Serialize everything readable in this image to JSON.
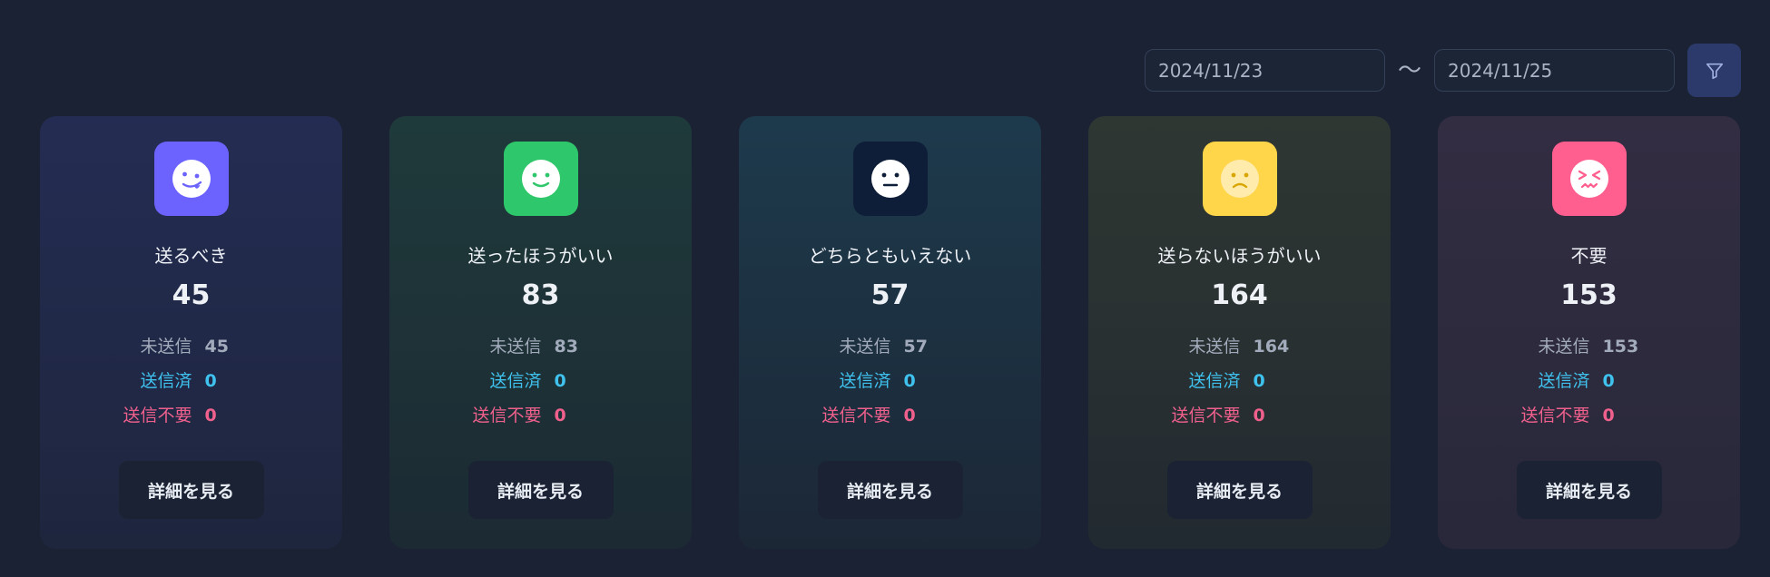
{
  "filter": {
    "start_date": "2024/11/23",
    "separator": "〜",
    "end_date": "2024/11/25",
    "button_icon": "filter-icon"
  },
  "colors": {
    "background": "#1a2233",
    "sent": "#3fc2ee",
    "no_send": "#f0608d",
    "unsent": "#a2abbb"
  },
  "cards": [
    {
      "title": "送るべき",
      "total": "45",
      "icon": "tongue-out-face-icon",
      "icon_color": "#6c63ff",
      "unsent_label": "未送信",
      "unsent": "45",
      "sent_label": "送信済",
      "sent": "0",
      "no_send_label": "送信不要",
      "no_send": "0",
      "button": "詳細を見る"
    },
    {
      "title": "送ったほうがいい",
      "total": "83",
      "icon": "smile-face-icon",
      "icon_color": "#2fc76b",
      "unsent_label": "未送信",
      "unsent": "83",
      "sent_label": "送信済",
      "sent": "0",
      "no_send_label": "送信不要",
      "no_send": "0",
      "button": "詳細を見る"
    },
    {
      "title": "どちらともいえない",
      "total": "57",
      "icon": "neutral-face-icon",
      "icon_color": "#0f1e38",
      "unsent_label": "未送信",
      "unsent": "57",
      "sent_label": "送信済",
      "sent": "0",
      "no_send_label": "送信不要",
      "no_send": "0",
      "button": "詳細を見る"
    },
    {
      "title": "送らないほうがいい",
      "total": "164",
      "icon": "frown-face-icon",
      "icon_color": "#ffd54a",
      "unsent_label": "未送信",
      "unsent": "164",
      "sent_label": "送信済",
      "sent": "0",
      "no_send_label": "送信不要",
      "no_send": "0",
      "button": "詳細を見る"
    },
    {
      "title": "不要",
      "total": "153",
      "icon": "angry-face-icon",
      "icon_color": "#ff5f8f",
      "unsent_label": "未送信",
      "unsent": "153",
      "sent_label": "送信済",
      "sent": "0",
      "no_send_label": "送信不要",
      "no_send": "0",
      "button": "詳細を見る"
    }
  ]
}
